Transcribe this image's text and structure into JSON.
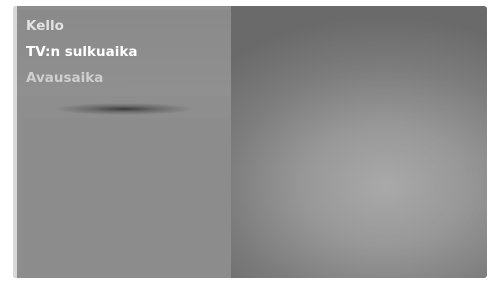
{
  "menu": {
    "items": [
      {
        "label": "Kello"
      },
      {
        "label": "TV:n sulkuaika"
      },
      {
        "label": "Avausaika"
      }
    ]
  }
}
